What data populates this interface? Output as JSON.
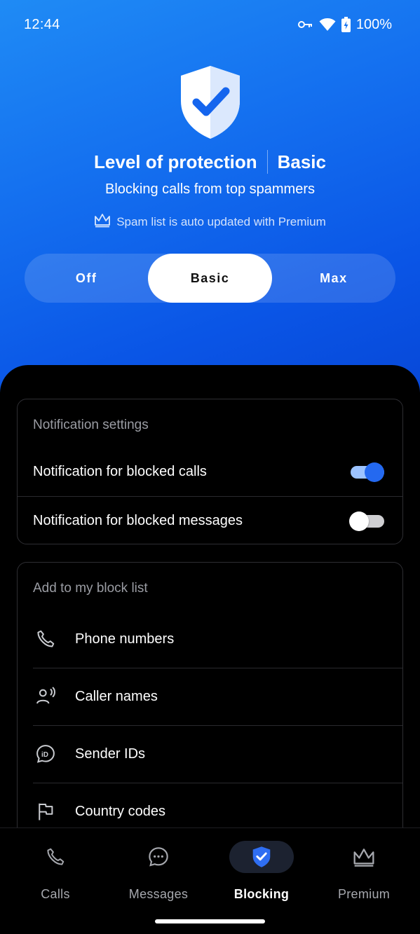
{
  "status_bar": {
    "time": "12:44",
    "battery": "100%",
    "icons": [
      "vpn-key-icon",
      "wifi-icon",
      "battery-charging-icon"
    ]
  },
  "hero": {
    "title": "Level of protection",
    "level": "Basic",
    "subtitle": "Blocking calls from top spammers",
    "premium_note": "Spam list is auto updated with Premium",
    "segments": [
      {
        "label": "Off",
        "active": false
      },
      {
        "label": "Basic",
        "active": true
      },
      {
        "label": "Max",
        "active": false
      }
    ],
    "colors": {
      "gradient_start": "#1f8bf5",
      "gradient_end": "#0748d8"
    }
  },
  "notification_settings": {
    "header": "Notification settings",
    "items": [
      {
        "label": "Notification for blocked calls",
        "enabled": true
      },
      {
        "label": "Notification for blocked messages",
        "enabled": false
      }
    ]
  },
  "block_list": {
    "header": "Add to my block list",
    "items": [
      {
        "label": "Phone numbers",
        "icon": "phone-icon"
      },
      {
        "label": "Caller names",
        "icon": "caller-name-icon"
      },
      {
        "label": "Sender IDs",
        "icon": "sender-id-icon"
      },
      {
        "label": "Country codes",
        "icon": "flag-icon"
      }
    ]
  },
  "bottom_nav": {
    "items": [
      {
        "label": "Calls",
        "icon": "phone-icon",
        "active": false
      },
      {
        "label": "Messages",
        "icon": "chat-bubble-icon",
        "active": false
      },
      {
        "label": "Blocking",
        "icon": "shield-check-icon",
        "active": true
      },
      {
        "label": "Premium",
        "icon": "crown-icon",
        "active": false
      }
    ],
    "accent": "#2f6ef2"
  }
}
